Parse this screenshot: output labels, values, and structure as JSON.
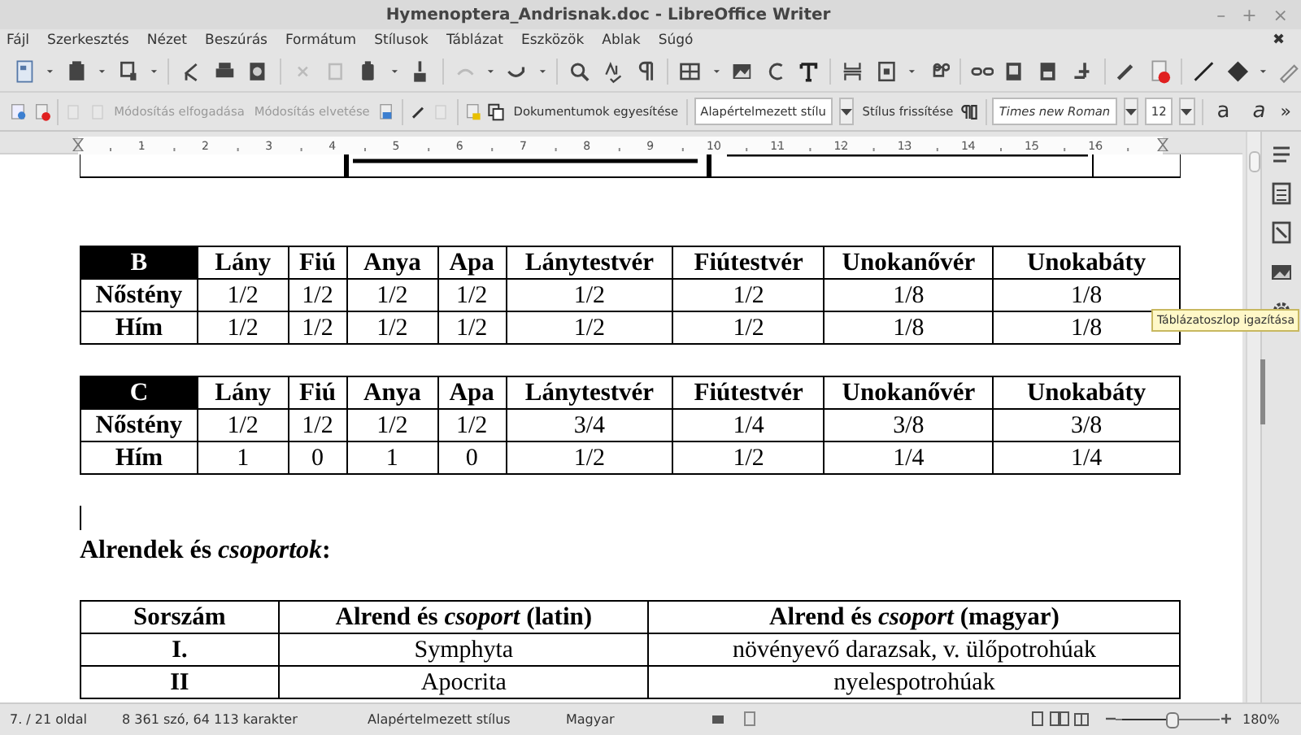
{
  "window": {
    "title": "Hymenoptera_Andrisnak.doc - LibreOffice Writer",
    "controls": [
      "–",
      "+",
      "×"
    ]
  },
  "menu": {
    "items": [
      "Fájl",
      "Szerkesztés",
      "Nézet",
      "Beszúrás",
      "Formátum",
      "Stílusok",
      "Táblázat",
      "Eszközök",
      "Ablak",
      "Súgó"
    ],
    "close_document": "✖"
  },
  "track_changes_toolbar": {
    "buttons": [
      {
        "label": "Módosítás elfogadása",
        "disabled": true
      },
      {
        "label": "Módosítás elvetése",
        "disabled": true
      },
      {
        "label": "Dokumentumok egyesítése",
        "disabled": false
      }
    ],
    "paragraph_style": "Alapértelmezett stílu",
    "update_style": "Stílus frissítése",
    "font_name": "Times new Roman",
    "font_size": "12",
    "style_buttons": [
      "a",
      "a"
    ],
    "overflow": "»"
  },
  "ruler": {
    "numbers": [
      "1",
      "2",
      "3",
      "4",
      "5",
      "6",
      "7",
      "8",
      "9",
      "10",
      "11",
      "12",
      "13",
      "14",
      "15",
      "16"
    ]
  },
  "tables": [
    {
      "corner": "B",
      "columns": [
        "Lány",
        "Fiú",
        "Anya",
        "Apa",
        "Lánytestvér",
        "Fiútestvér",
        "Unokanővér",
        "Unokabáty"
      ],
      "rows": [
        {
          "label": "Nőstény",
          "cells": [
            "1/2",
            "1/2",
            "1/2",
            "1/2",
            "1/2",
            "1/2",
            "1/8",
            "1/8"
          ]
        },
        {
          "label": "Hím",
          "cells": [
            "1/2",
            "1/2",
            "1/2",
            "1/2",
            "1/2",
            "1/2",
            "1/8",
            "1/8"
          ]
        }
      ]
    },
    {
      "corner": "C",
      "columns": [
        "Lány",
        "Fiú",
        "Anya",
        "Apa",
        "Lánytestvér",
        "Fiútestvér",
        "Unokanővér",
        "Unokabáty"
      ],
      "rows": [
        {
          "label": "Nőstény",
          "cells": [
            "1/2",
            "1/2",
            "1/2",
            "1/2",
            "3/4",
            "1/4",
            "3/8",
            "3/8"
          ]
        },
        {
          "label": "Hím",
          "cells": [
            "1",
            "0",
            "1",
            "0",
            "1/2",
            "1/2",
            "1/4",
            "1/4"
          ]
        }
      ]
    }
  ],
  "heading": "Alrendek és *csoportok*:",
  "suborder_table": {
    "columns": [
      "Sorszám",
      "Alrend és *csoport* (latin)",
      "Alrend és *csoport* (magyar)"
    ],
    "rows": [
      [
        "I.",
        "Symphyta",
        "növényevő darazsak, v. ülőpotrohúak"
      ],
      [
        "II",
        "Apocrita",
        "nyelespotrohúak"
      ]
    ]
  },
  "tooltip": "Táblázatoszlop igazítása",
  "status_bar": {
    "page": "7. / 21 oldal",
    "word_count": "8 361 szó, 64 113 karakter",
    "page_style": "Alapértelmezett stílus",
    "language": "Magyar",
    "zoom": {
      "level": 0.55,
      "reading": "180%"
    }
  }
}
